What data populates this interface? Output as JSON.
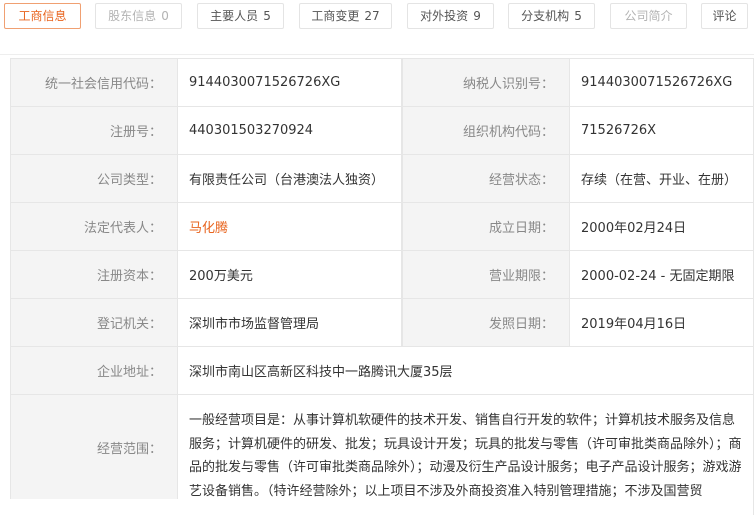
{
  "tabs": [
    {
      "label": "工商信息",
      "count": "",
      "state": "active"
    },
    {
      "label": "股东信息",
      "count": "0",
      "state": "disabled"
    },
    {
      "label": "主要人员",
      "count": "5",
      "state": "normal"
    },
    {
      "label": "工商变更",
      "count": "27",
      "state": "normal"
    },
    {
      "label": "对外投资",
      "count": "9",
      "state": "normal"
    },
    {
      "label": "分支机构",
      "count": "5",
      "state": "normal"
    },
    {
      "label": "公司简介",
      "count": "",
      "state": "disabled"
    },
    {
      "label": "评论",
      "count": "",
      "state": "normal"
    }
  ],
  "info": {
    "credit_code_label": "统一社会信用代码：",
    "credit_code": "9144030071526726XG",
    "taxpayer_label": "纳税人识别号：",
    "taxpayer": "9144030071526726XG",
    "reg_no_label": "注册号：",
    "reg_no": "440301503270924",
    "org_code_label": "组织机构代码：",
    "org_code": "71526726X",
    "company_type_label": "公司类型：",
    "company_type": "有限责任公司（台港澳法人独资）",
    "status_label": "经营状态：",
    "status": "存续（在营、开业、在册）",
    "legal_rep_label": "法定代表人：",
    "legal_rep": "马化腾",
    "founded_label": "成立日期：",
    "founded": "2000年02月24日",
    "capital_label": "注册资本：",
    "capital": "200万美元",
    "term_label": "营业期限：",
    "term": "2000-02-24 - 无固定期限",
    "authority_label": "登记机关：",
    "authority": "深圳市市场监督管理局",
    "issue_date_label": "发照日期：",
    "issue_date": "2019年04月16日",
    "address_label": "企业地址：",
    "address": "深圳市南山区高新区科技中一路腾讯大厦35层",
    "scope_label": "经营范围：",
    "scope": "一般经营项目是：从事计算机软硬件的技术开发、销售自行开发的软件；计算机技术服务及信息服务；计算机硬件的研发、批发；玩具设计开发；玩具的批发与零售（许可审批类商品除外）；商品的批发与零售（许可审批类商品除外）；动漫及衍生产品设计服务；电子产品设计服务；游戏游艺设备销售。（特许经营除外；以上项目不涉及外商投资准入特别管理措施；不涉及国营贸"
  }
}
